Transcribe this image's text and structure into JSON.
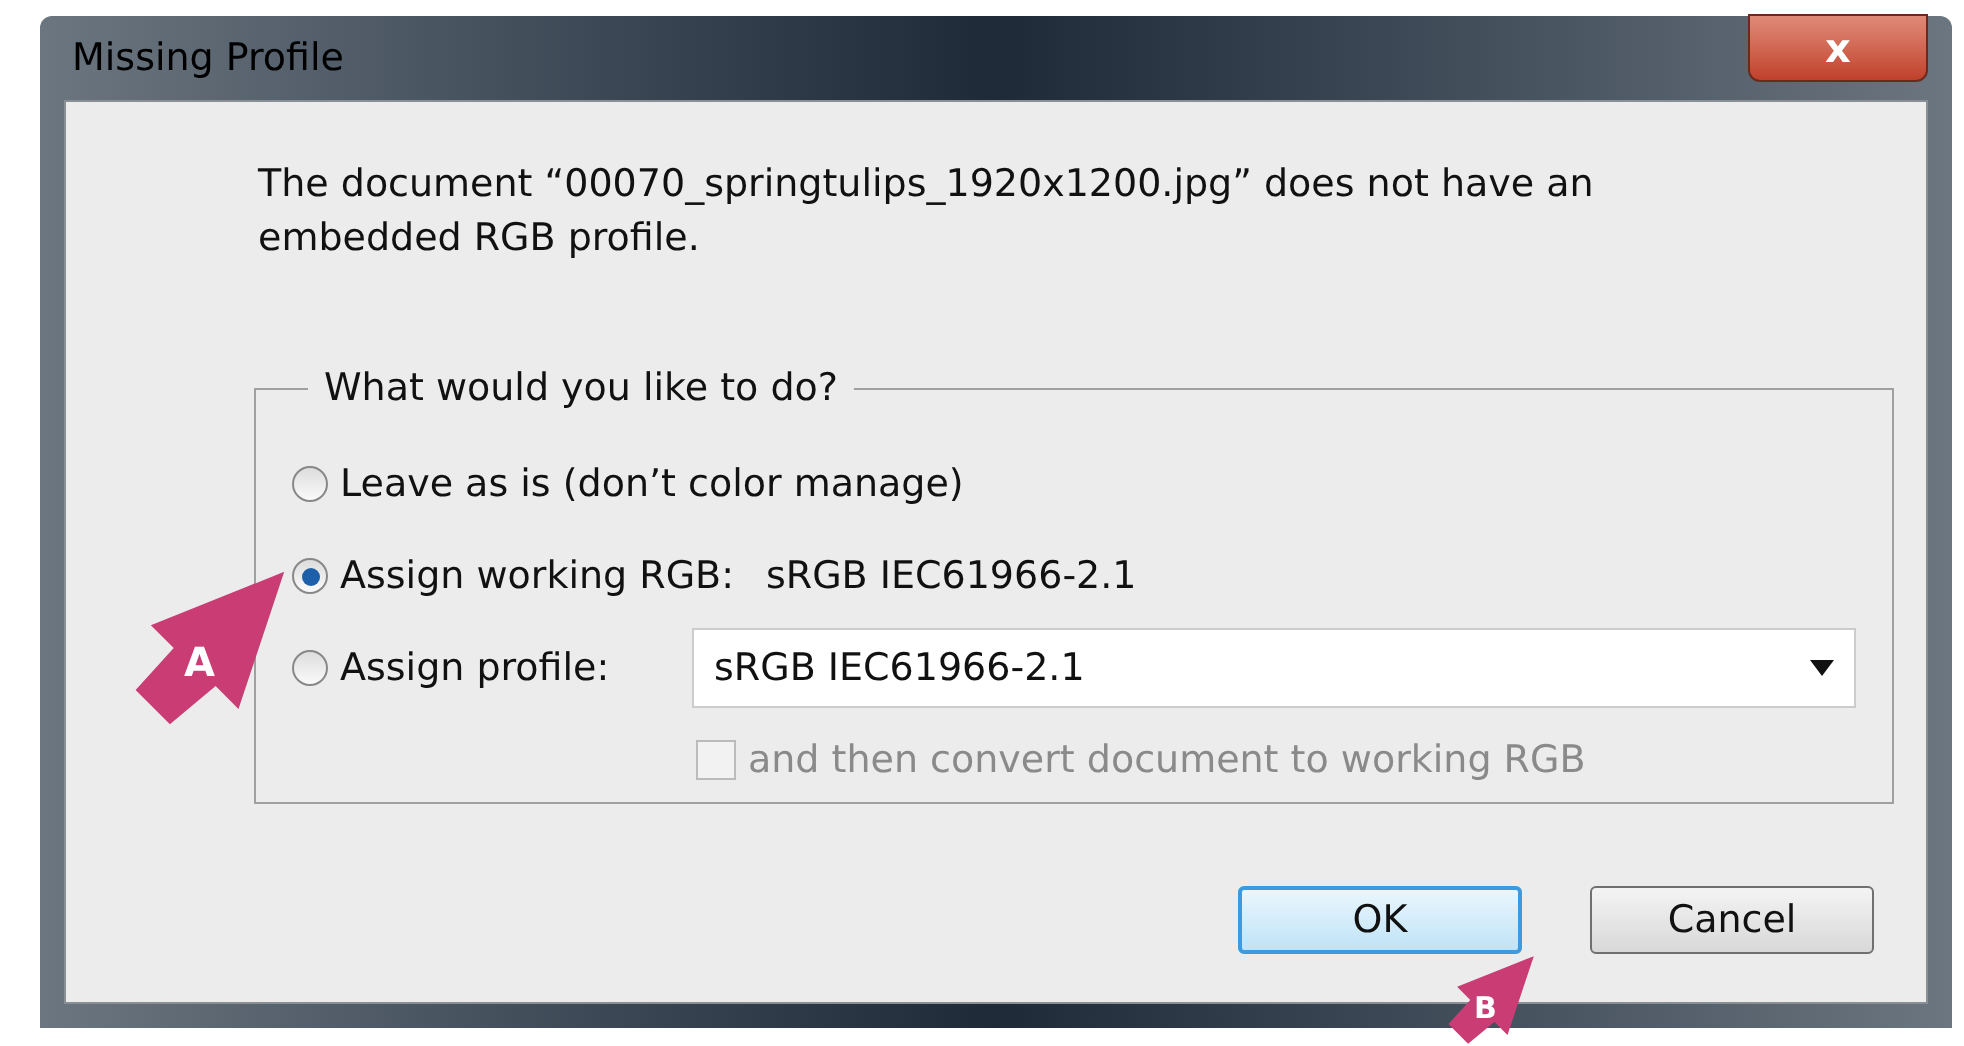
{
  "window": {
    "title": "Missing Profile",
    "close_label": "x"
  },
  "message": "The document “00070_springtulips_1920x1200.jpg” does not have an embedded RGB profile.",
  "group": {
    "title": "What would you like to do?",
    "options": [
      {
        "label": "Leave as is (don’t color manage)",
        "selected": false
      },
      {
        "label": "Assign working RGB:",
        "value": "sRGB IEC61966-2.1",
        "selected": true
      },
      {
        "label": "Assign profile:",
        "dropdown": "sRGB IEC61966-2.1",
        "selected": false
      }
    ],
    "convert": {
      "label": "and then convert document to working RGB",
      "checked": false,
      "disabled": true
    }
  },
  "buttons": [
    {
      "label": "OK",
      "default": true
    },
    {
      "label": "Cancel",
      "default": false
    }
  ],
  "callouts": [
    {
      "label": "A"
    },
    {
      "label": "B"
    }
  ]
}
